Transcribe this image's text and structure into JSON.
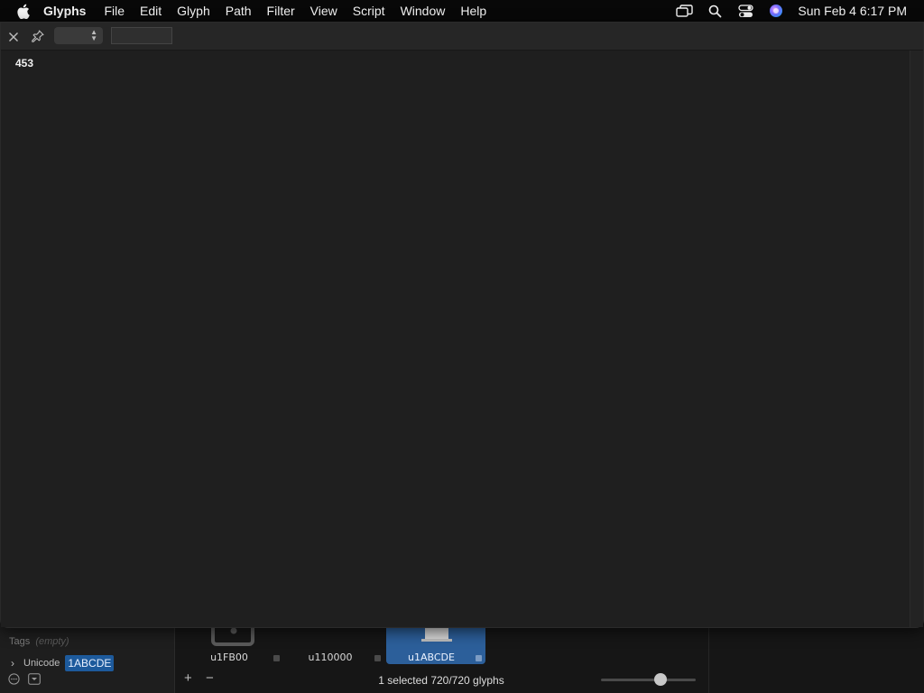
{
  "menubar": {
    "app_name": "Glyphs",
    "items": [
      "File",
      "Edit",
      "Glyph",
      "Path",
      "Filter",
      "View",
      "Script",
      "Window",
      "Help"
    ],
    "clock": "Sun Feb 4  6:17 PM",
    "status_icons": [
      "screen-mirroring-icon",
      "spotlight-search-icon",
      "control-center-icon",
      "siri-icon"
    ]
  },
  "preview_window": {
    "value": "453"
  },
  "info_panel": {
    "tags_label": "Tags",
    "tags_value": "(empty)",
    "unicode_label": "Unicode",
    "unicode_value": "1ABCDE"
  },
  "glyph_grid": {
    "cells": [
      {
        "name": "u1FB00",
        "selected": false
      },
      {
        "name": "u110000",
        "selected": false
      },
      {
        "name": "u1ABCDE",
        "selected": true
      }
    ]
  },
  "bottom_bar": {
    "add": "+",
    "remove": "−",
    "status": "1 selected 720/720 glyphs",
    "zoom_level": 0.65
  },
  "colors": {
    "selection": "#2c5f9a",
    "unicode_highlight": "#1d5a9c",
    "background": "#1f1f1f"
  }
}
